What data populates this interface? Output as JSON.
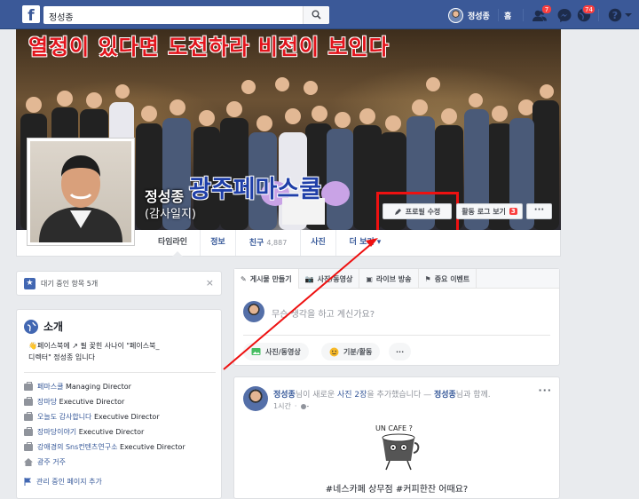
{
  "topbar": {
    "logo": "f",
    "search_value": "정성종",
    "user_name": "정성종",
    "home_label": "홈",
    "friend_badge": "7",
    "notif_badge": "74",
    "icons": [
      "friends-icon",
      "messenger-icon",
      "globe-notifications-icon",
      "help-icon",
      "dropdown-icon"
    ]
  },
  "cover": {
    "banner_text": "열정이 있다면 도전하라 비전이 보인다",
    "overlay_text": "광주페마스쿨",
    "name": "정성종",
    "subname": "(감사일지)",
    "edit_profile_label": "프로필 수정",
    "activity_log_label": "활동 로그 보기",
    "activity_log_count": "3",
    "more_label": "···"
  },
  "nav": {
    "tabs": [
      {
        "label": "타임라인"
      },
      {
        "label": "정보"
      },
      {
        "label": "친구",
        "count": "4,887"
      },
      {
        "label": "사진"
      },
      {
        "label": "더 보기"
      }
    ]
  },
  "pending": {
    "label": "대기 중인 항목 5개",
    "close": "×"
  },
  "intro": {
    "title": "소개",
    "bio_line1": "페이스북에 ↗ 필 꽂힌 사나이 \"페이스북_",
    "bio_line2": "디렉터\" 정성종 입니다",
    "work": [
      {
        "link": "페마스쿨",
        "rest": " Managing Director"
      },
      {
        "link": "장마당",
        "rest": " Executive Director"
      },
      {
        "link": "오늘도 감사합니다",
        "rest": " Executive Director"
      },
      {
        "link": "장마당이야기",
        "rest": " Executive Director"
      },
      {
        "link": "강애경의 Sns컨텐츠연구소",
        "rest": " Executive Director"
      }
    ],
    "home": "광주 거주",
    "manage_pages": "관리 중인 페이지 추가"
  },
  "composer": {
    "tabs": [
      "게시물 만들기",
      "사진/동영상",
      "라이브 방송",
      "중요 이벤트"
    ],
    "placeholder": "무슨 생각을 하고 계신가요?",
    "buttons": [
      "사진/동영상",
      "기분/활동",
      "···"
    ]
  },
  "post": {
    "author": "정성종",
    "action_prefix": "님이 새로운 ",
    "photo_count": "사진 2장",
    "action_suffix": "을 추가했습니다 — ",
    "tagged": "정성종",
    "tag_suffix": "님과 함께.",
    "time": "1시간",
    "more": "···",
    "image_text": "UN CAFE ?",
    "caption": "#네스카페 상무점 #커피한잔 어때요?"
  },
  "colors": {
    "fb_blue": "#3b5998",
    "highlight_red": "#e11111",
    "link_blue": "#365899",
    "badge_red": "#fa3e3e"
  }
}
